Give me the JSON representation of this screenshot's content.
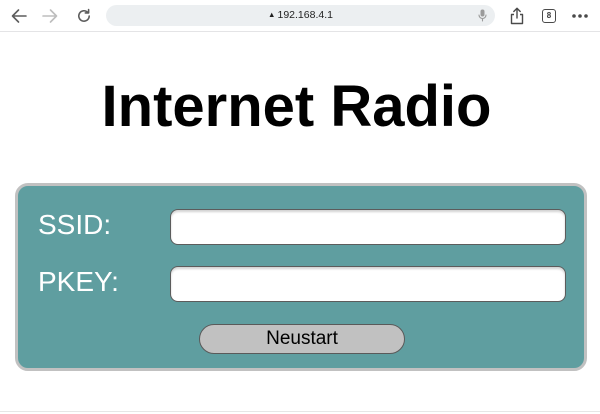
{
  "browser": {
    "url": "192.168.4.1",
    "insecure_marker": "▲",
    "tab_count": "8",
    "icons": {
      "back": "arrow-left-icon",
      "forward": "arrow-right-icon",
      "reload": "reload-icon",
      "mic": "microphone-icon",
      "share": "share-icon",
      "tabs": "tabs-icon",
      "more": "more-dots-icon"
    }
  },
  "page": {
    "title": "Internet Radio"
  },
  "form": {
    "ssid_label": "SSID:",
    "ssid_value": "",
    "pkey_label": "PKEY:",
    "pkey_value": "",
    "submit_label": "Neustart"
  },
  "colors": {
    "panel_background": "#5f9ea0",
    "panel_border": "#c1c1c1",
    "button_background": "#c1c1c1",
    "label_text": "#ffffff"
  }
}
